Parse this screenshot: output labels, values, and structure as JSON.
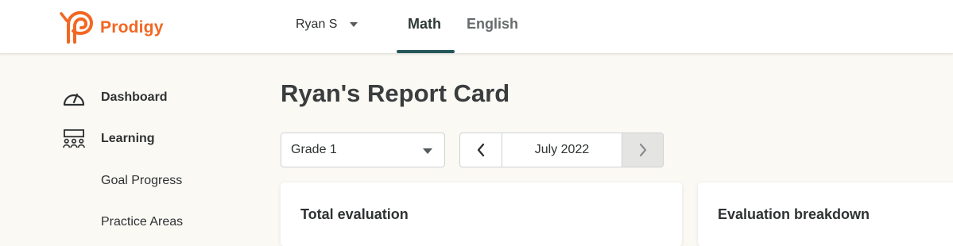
{
  "header": {
    "brand": "Prodigy",
    "user": {
      "name": "Ryan S"
    },
    "tabs": [
      {
        "label": "Math",
        "active": true
      },
      {
        "label": "English",
        "active": false
      }
    ]
  },
  "sidebar": {
    "items": [
      {
        "label": "Dashboard",
        "icon": "gauge-icon"
      },
      {
        "label": "Learning",
        "icon": "classroom-icon"
      },
      {
        "label": "Goal Progress"
      },
      {
        "label": "Practice Areas"
      }
    ]
  },
  "main": {
    "title": "Ryan's Report Card",
    "grade_select": {
      "value": "Grade 1"
    },
    "month_nav": {
      "label": "July 2022"
    },
    "cards": [
      {
        "title": "Total evaluation"
      },
      {
        "title": "Evaluation breakdown"
      }
    ]
  },
  "colors": {
    "brand_orange": "#f26722",
    "tab_underline": "#25575a",
    "background": "#fbf9f4"
  }
}
